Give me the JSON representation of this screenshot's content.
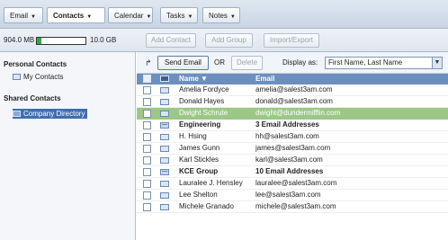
{
  "nav_tabs": [
    {
      "label": "Email"
    },
    {
      "label": "Contacts"
    },
    {
      "label": "Calendar"
    },
    {
      "label": "Tasks"
    },
    {
      "label": "Notes"
    }
  ],
  "storage": {
    "used": "904.0 MB",
    "max": "10.0 GB",
    "used_fraction": 0.09
  },
  "toolbar": {
    "add_contact": "Add Contact",
    "add_group": "Add Group",
    "import_export": "Import/Export"
  },
  "sidebar": {
    "personal_heading": "Personal Contacts",
    "my_contacts": "My Contacts",
    "shared_heading": "Shared Contacts",
    "company_directory": "Company Directory"
  },
  "actions": {
    "send_email": "Send Email",
    "or_text": "OR",
    "delete": "Delete",
    "display_as_label": "Display as:",
    "display_as_value": "First Name, Last Name"
  },
  "table": {
    "col_name": "Name",
    "col_email": "Email",
    "rows": [
      {
        "name": "Amelia Fordyce",
        "email": "amelia@salest3am.com",
        "type": "contact"
      },
      {
        "name": "Donald Hayes",
        "email": "donald@salest3am.com",
        "type": "contact"
      },
      {
        "name": "Dwight Schrute",
        "email": "dwight@dundermifflin.com",
        "type": "contact",
        "selected": true
      },
      {
        "name": "Engineering",
        "email": "3 Email Addresses",
        "type": "group"
      },
      {
        "name": "H. Hsing",
        "email": "hh@salest3am.com",
        "type": "contact"
      },
      {
        "name": "James Gunn",
        "email": "james@salest3am.com",
        "type": "contact"
      },
      {
        "name": "Karl Stickles",
        "email": "karl@salest3am.com",
        "type": "contact"
      },
      {
        "name": "KCE Group",
        "email": "10 Email Addresses",
        "type": "group"
      },
      {
        "name": "Lauralee J. Hensley",
        "email": "lauralee@salest3am.com",
        "type": "contact"
      },
      {
        "name": "Lee Shelton",
        "email": "lee@salest3am.com",
        "type": "contact"
      },
      {
        "name": "Michele Granado",
        "email": "michele@salest3am.com",
        "type": "contact"
      }
    ]
  },
  "colors": {
    "header": "#6c8fbf",
    "selected_row": "#9cc787",
    "sidebar_selected": "#3f6eb0"
  }
}
